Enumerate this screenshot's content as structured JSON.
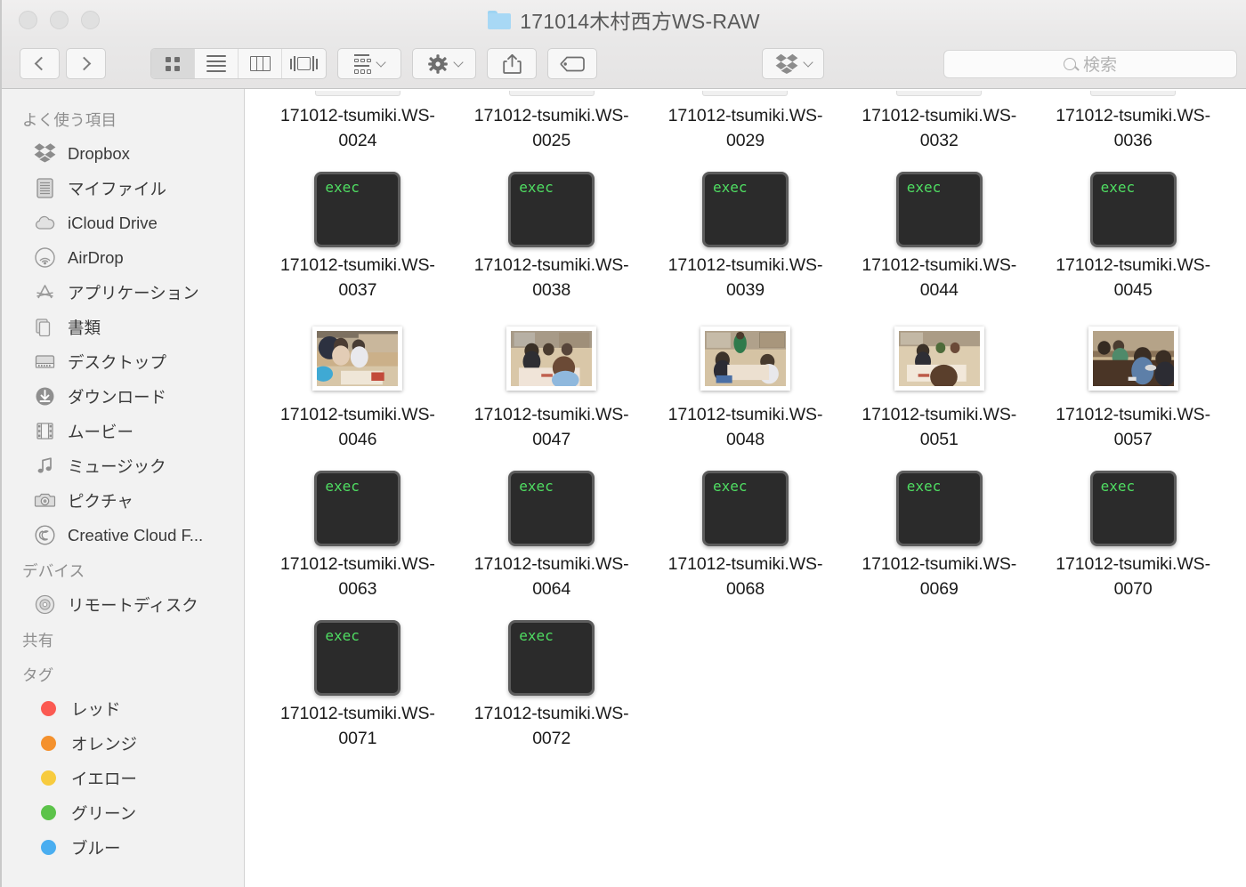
{
  "window": {
    "title": "171014木村西方WS-RAW",
    "folder_icon": "folder-icon",
    "traffic_lights": [
      "close-button",
      "minimize-button",
      "zoom-button"
    ]
  },
  "toolbar": {
    "back_label": "back",
    "forward_label": "forward",
    "view_modes": [
      {
        "name": "icon-view",
        "active": true
      },
      {
        "name": "list-view",
        "active": false
      },
      {
        "name": "column-view",
        "active": false
      },
      {
        "name": "coverflow-view",
        "active": false
      }
    ],
    "arrange_label": "arrange",
    "action_label": "action",
    "share_label": "share",
    "tag_label": "tag",
    "dropbox_label": "dropbox"
  },
  "search": {
    "placeholder": "検索",
    "value": ""
  },
  "sidebar": {
    "sections": [
      {
        "header": "よく使う項目",
        "items": [
          {
            "label": "Dropbox",
            "icon": "dropbox-icon"
          },
          {
            "label": "マイファイル",
            "icon": "myfiles-icon"
          },
          {
            "label": "iCloud Drive",
            "icon": "icloud-icon"
          },
          {
            "label": "AirDrop",
            "icon": "airdrop-icon"
          },
          {
            "label": "アプリケーション",
            "icon": "applications-icon"
          },
          {
            "label": "書類",
            "icon": "documents-icon"
          },
          {
            "label": "デスクトップ",
            "icon": "desktop-icon"
          },
          {
            "label": "ダウンロード",
            "icon": "downloads-icon"
          },
          {
            "label": "ムービー",
            "icon": "movies-icon"
          },
          {
            "label": "ミュージック",
            "icon": "music-icon"
          },
          {
            "label": "ピクチャ",
            "icon": "pictures-icon"
          },
          {
            "label": "Creative Cloud F...",
            "icon": "creative-cloud-icon"
          }
        ]
      },
      {
        "header": "デバイス",
        "items": [
          {
            "label": "リモートディスク",
            "icon": "remote-disc-icon"
          }
        ]
      },
      {
        "header": "共有",
        "items": []
      },
      {
        "header": "タグ",
        "items": [
          {
            "label": "レッド",
            "color": "#fb5a52"
          },
          {
            "label": "オレンジ",
            "color": "#f4912d"
          },
          {
            "label": "イエロー",
            "color": "#f7cb3e"
          },
          {
            "label": "グリーン",
            "color": "#5cc34a"
          },
          {
            "label": "ブルー",
            "color": "#4aaef0"
          }
        ]
      }
    ]
  },
  "files": {
    "rows": [
      {
        "name_row": true,
        "items": [
          {
            "name": "171012-tsumiki.WS-0024",
            "type": "exec"
          },
          {
            "name": "171012-tsumiki.WS-0025",
            "type": "exec"
          },
          {
            "name": "171012-tsumiki.WS-0029",
            "type": "exec"
          },
          {
            "name": "171012-tsumiki.WS-0032",
            "type": "exec"
          },
          {
            "name": "171012-tsumiki.WS-0036",
            "type": "exec"
          }
        ]
      },
      {
        "items": [
          {
            "name": "171012-tsumiki.WS-0037",
            "type": "exec"
          },
          {
            "name": "171012-tsumiki.WS-0038",
            "type": "exec"
          },
          {
            "name": "171012-tsumiki.WS-0039",
            "type": "exec"
          },
          {
            "name": "171012-tsumiki.WS-0044",
            "type": "exec"
          },
          {
            "name": "171012-tsumiki.WS-0045",
            "type": "exec"
          }
        ]
      },
      {
        "items": [
          {
            "name": "171012-tsumiki.WS-0046",
            "type": "photo",
            "photo": "workshop-a"
          },
          {
            "name": "171012-tsumiki.WS-0047",
            "type": "photo",
            "photo": "workshop-b"
          },
          {
            "name": "171012-tsumiki.WS-0048",
            "type": "photo",
            "photo": "workshop-c"
          },
          {
            "name": "171012-tsumiki.WS-0051",
            "type": "photo",
            "photo": "workshop-d"
          },
          {
            "name": "171012-tsumiki.WS-0057",
            "type": "photo",
            "photo": "workshop-e"
          }
        ]
      },
      {
        "items": [
          {
            "name": "171012-tsumiki.WS-0063",
            "type": "exec"
          },
          {
            "name": "171012-tsumiki.WS-0064",
            "type": "exec"
          },
          {
            "name": "171012-tsumiki.WS-0068",
            "type": "exec"
          },
          {
            "name": "171012-tsumiki.WS-0069",
            "type": "exec"
          },
          {
            "name": "171012-tsumiki.WS-0070",
            "type": "exec"
          }
        ]
      },
      {
        "items": [
          {
            "name": "171012-tsumiki.WS-0071",
            "type": "exec"
          },
          {
            "name": "171012-tsumiki.WS-0072",
            "type": "exec"
          }
        ]
      }
    ],
    "exec_badge": "exec"
  },
  "colors": {
    "exec_text": "#4fdd62",
    "exec_bg": "#2b2b2b",
    "folder_blue": "#a8d8f5"
  }
}
